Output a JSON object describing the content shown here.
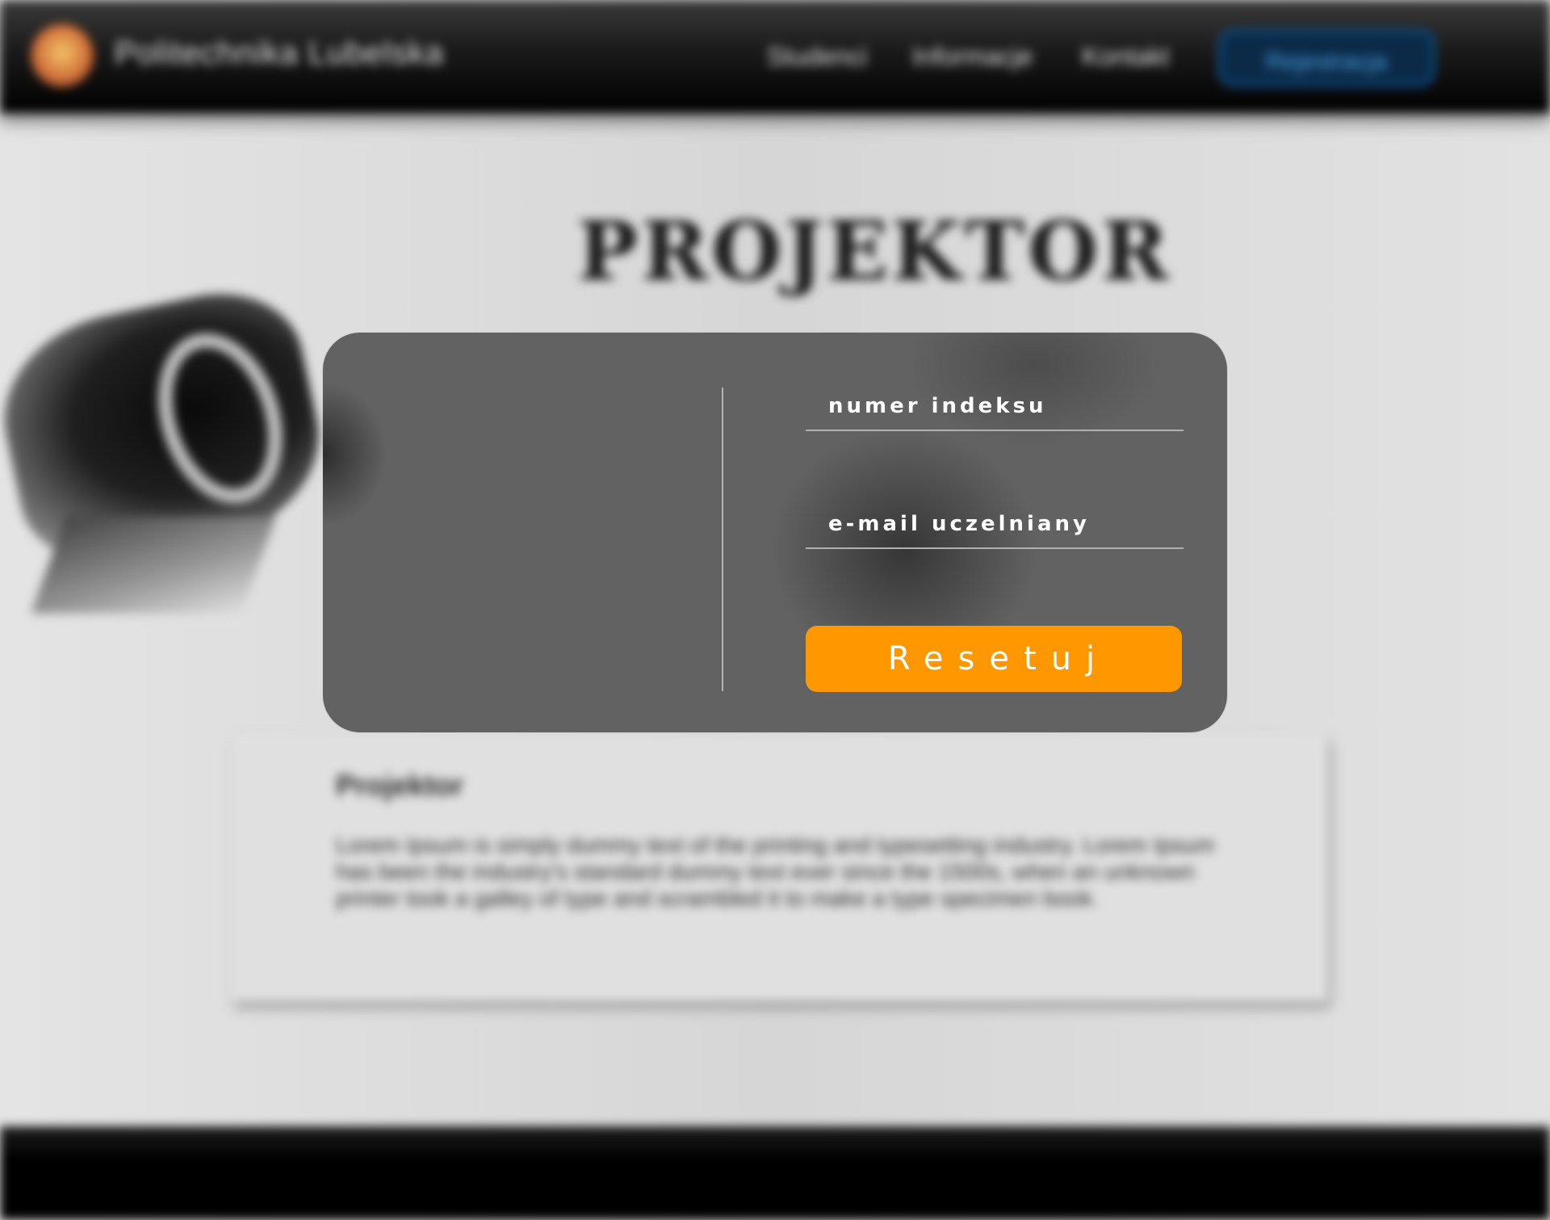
{
  "header": {
    "brand": "Politechnika Lubelska",
    "nav": [
      "Studenci",
      "Informacje",
      "Kontakt"
    ],
    "register_label": "Rejestracja"
  },
  "hero": {
    "title": "PROJEKTOR"
  },
  "card": {
    "title": "Projektor",
    "text": "Lorem Ipsum is simply dummy text of the printing and typesetting industry. Lorem Ipsum has been the industry's standard dummy text ever since the 1500s, when an unknown printer took a galley of type and scrambled it to make a type specimen book."
  },
  "modal": {
    "index_placeholder": "numer indeksu",
    "email_placeholder": "e-mail uczelniany",
    "reset_label": "Resetuj"
  },
  "colors": {
    "accent": "#ff9800",
    "modal_bg": "#626262",
    "register_border": "#0a4f86"
  }
}
